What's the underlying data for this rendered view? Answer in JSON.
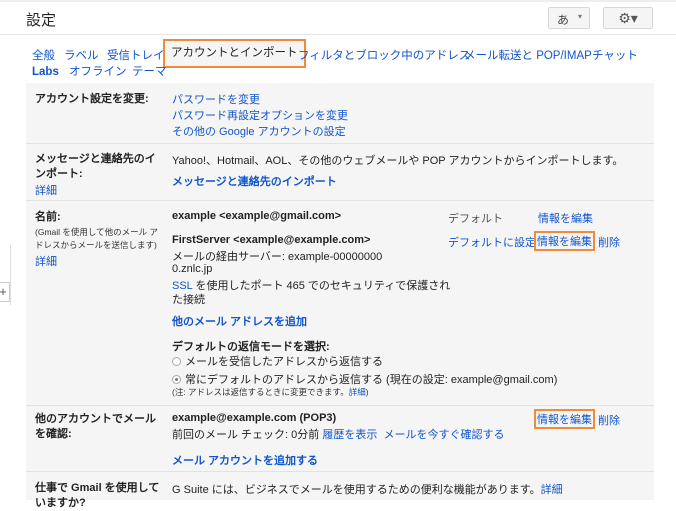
{
  "header": {
    "title": "設定",
    "ime_label": "あ",
    "ime_caret": "▾",
    "gear_icon": "gear-icon",
    "gear_glyph": "⚙▾"
  },
  "tabs": [
    {
      "label": "全般"
    },
    {
      "label": "ラベル"
    },
    {
      "label": "受信トレイ"
    },
    {
      "label": "アカウントとインポート",
      "active": true
    },
    {
      "label": "フィルタとブロック中のアドレス"
    },
    {
      "label": "メール転送と POP/IMAP"
    },
    {
      "label": "チャット"
    },
    {
      "label": "Labs"
    },
    {
      "label": "オフライン"
    },
    {
      "label": "テーマ"
    }
  ],
  "sections": {
    "account": {
      "label": "アカウント設定を変更:",
      "links": [
        "パスワードを変更",
        "パスワード再設定オプションを変更",
        "その他の Google アカウントの設定"
      ]
    },
    "import": {
      "label": "メッセージと連絡先のインポート:",
      "detail": "詳細",
      "text": "Yahoo!、Hotmail、AOL、その他のウェブメールや POP アカウントからインポートします。",
      "link": "メッセージと連絡先のインポート"
    },
    "sendas": {
      "label": "名前:",
      "note": "(Gmail を使用して他のメール アドレスからメールを送信します)",
      "detail": "詳細",
      "addr1": "example <example@gmail.com>",
      "default": "デフォルト",
      "edit": "情報を編集",
      "addr2": "FirstServer <example@example.com>",
      "server1": "メールの経由サーバー: example-00000000",
      "server2": "0.znlc.jp",
      "ssl": "SSL",
      "ssl_text1": " を使用したポート 465 でのセキュリティで保護され",
      "ssl_text2": "た接続",
      "make_default": "デフォルトに設定",
      "delete": "削除",
      "add": "他のメール アドレスを追加",
      "reply_title": "デフォルトの返信モードを選択:",
      "reply_opt1": "メールを受信したアドレスから返信する",
      "reply_opt2": "常にデフォルトのアドレスから返信する (現在の設定: example@gmail.com)",
      "reply_selected": 2,
      "reply_note": "(注: アドレスは返信するときに変更できます。",
      "reply_note_link": "詳細",
      "reply_note_close": ")"
    },
    "checkmail": {
      "label": "他のアカウントでメールを確認:",
      "account": "example@example.com (POP3)",
      "last_check": "前回のメール チェック: 0分前",
      "history": "履歴を表示",
      "check_now": "メールを今すぐ確認する",
      "edit": "情報を編集",
      "delete": "削除",
      "add": "メール アカウントを追加する"
    },
    "gsuite": {
      "label": "仕事で Gmail を使用していますか?",
      "text": "G Suite には、ビジネスでメールを使用するための便利な機能があります。",
      "detail": "詳細"
    }
  },
  "side": {
    "plus": "+"
  },
  "colors": {
    "highlight": "#f08a3c",
    "link": "#1155cc"
  }
}
